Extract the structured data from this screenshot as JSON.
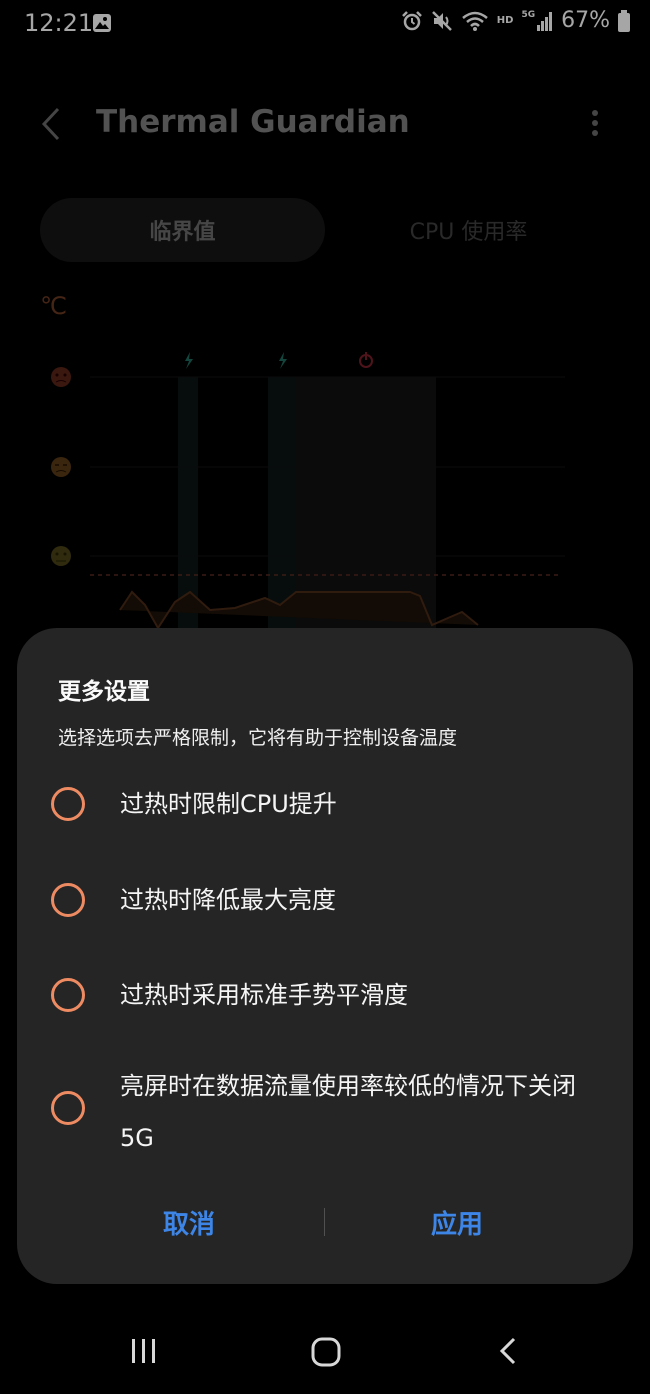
{
  "status_bar": {
    "time": "12:21",
    "network_hd": "HD",
    "network_5g": "5G",
    "battery": "67%"
  },
  "app": {
    "title": "Thermal Guardian",
    "tabs": [
      {
        "label": "临界值",
        "active": true
      },
      {
        "label": "CPU 使用率",
        "active": false
      }
    ],
    "chart": {
      "unit": "℃",
      "level_icons": [
        "angry-face-icon",
        "tired-face-icon",
        "worried-face-icon"
      ],
      "event_icons": [
        "charging-bolt-icon",
        "charging-bolt-icon",
        "power-icon"
      ]
    }
  },
  "dialog": {
    "title": "更多设置",
    "description": "选择选项去严格限制，它将有助于控制设备温度",
    "options": [
      {
        "label": "过热时限制CPU提升",
        "checked": false
      },
      {
        "label": "过热时降低最大亮度",
        "checked": false
      },
      {
        "label": "过热时采用标准手势平滑度",
        "checked": false
      },
      {
        "label": "亮屏时在数据流量使用率较低的情况下关闭5G",
        "checked": false
      }
    ],
    "cancel_label": "取消",
    "apply_label": "应用"
  },
  "colors": {
    "accent_orange": "#ee8b62",
    "button_blue": "#3d86e8",
    "dialog_bg": "#252525"
  },
  "nav_bar": {
    "icons": [
      "recent-apps-icon",
      "home-icon",
      "back-icon"
    ]
  }
}
